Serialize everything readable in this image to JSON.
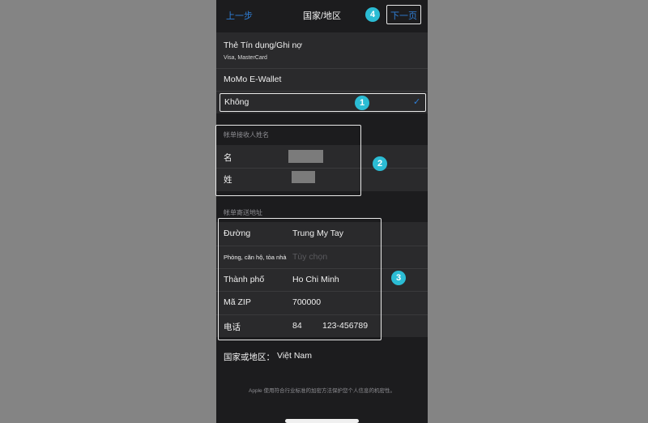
{
  "nav": {
    "back": "上一步",
    "title": "国家/地区",
    "next": "下一页"
  },
  "payment": {
    "card_title": "Thẻ Tín dụng/Ghi nợ",
    "card_sub": "Visa, MasterCard",
    "momo": "MoMo E-Wallet",
    "none": "Không",
    "check": "✓"
  },
  "billing_name": {
    "header": "帐单接收人姓名",
    "first_label": "名",
    "last_label": "姓"
  },
  "billing_address": {
    "header": "帐单寄送地址",
    "street_label": "Đường",
    "street_value": "Trung My Tay",
    "apt_label": "Phòng, căn hộ, tòa nhà",
    "apt_placeholder": "Tùy chọn",
    "city_label": "Thành phố",
    "city_value": "Ho Chi Minh",
    "zip_label": "Mã ZIP",
    "zip_value": "700000",
    "phone_label": "电话",
    "phone_code": "84",
    "phone_number": "123-456789"
  },
  "country": {
    "label": "国家或地区：",
    "value": "Việt Nam"
  },
  "footer_text": "Apple 使用符合行业标准的加密方法保护您个人信息的机密性。",
  "badges": {
    "one": "1",
    "two": "2",
    "three": "3",
    "four": "4"
  },
  "colors": {
    "accent": "#2f7fd8",
    "badge": "#2bbcd4",
    "background": "#848484",
    "panel": "#1c1c1e"
  }
}
